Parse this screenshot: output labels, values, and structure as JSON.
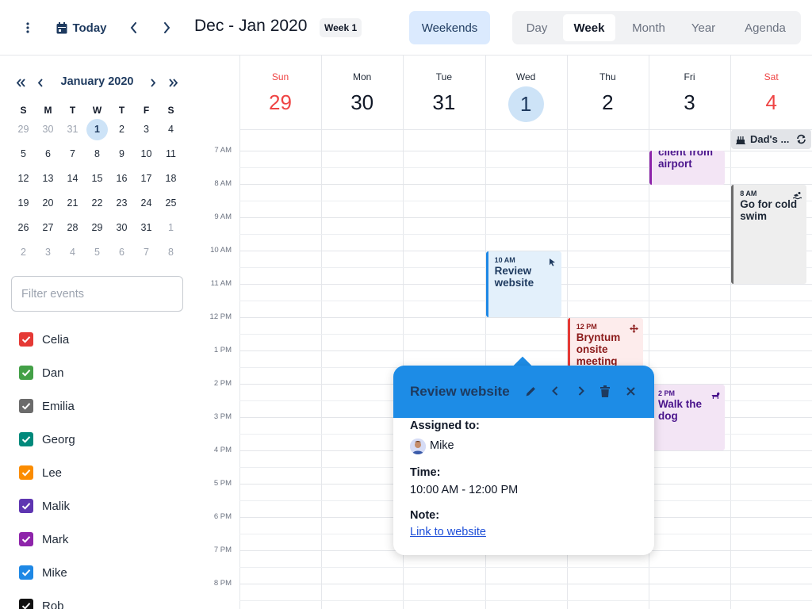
{
  "toolbar": {
    "today_label": "Today",
    "range_title": "Dec - Jan 2020",
    "week_badge": "Week 1",
    "weekends_label": "Weekends",
    "modes": [
      "Day",
      "Week",
      "Month",
      "Year",
      "Agenda"
    ],
    "active_mode": "Week"
  },
  "sidebar": {
    "month_title": "January 2020",
    "dow": [
      "S",
      "M",
      "T",
      "W",
      "T",
      "F",
      "S"
    ],
    "weeks": [
      [
        "29",
        "30",
        "31",
        "1",
        "2",
        "3",
        "4"
      ],
      [
        "5",
        "6",
        "7",
        "8",
        "9",
        "10",
        "11"
      ],
      [
        "12",
        "13",
        "14",
        "15",
        "16",
        "17",
        "18"
      ],
      [
        "19",
        "20",
        "21",
        "22",
        "23",
        "24",
        "25"
      ],
      [
        "26",
        "27",
        "28",
        "29",
        "30",
        "31",
        "1"
      ],
      [
        "2",
        "3",
        "4",
        "5",
        "6",
        "7",
        "8"
      ]
    ],
    "selected_day": "1",
    "filter_placeholder": "Filter events",
    "resources": [
      {
        "name": "Celia",
        "color": "#e53935"
      },
      {
        "name": "Dan",
        "color": "#43a047"
      },
      {
        "name": "Emilia",
        "color": "#6b6b6b"
      },
      {
        "name": "Georg",
        "color": "#00897b"
      },
      {
        "name": "Lee",
        "color": "#fb8c00"
      },
      {
        "name": "Malik",
        "color": "#5e35b1"
      },
      {
        "name": "Mark",
        "color": "#8e24aa"
      },
      {
        "name": "Mike",
        "color": "#1e88e5"
      },
      {
        "name": "Rob",
        "color": "#111111"
      }
    ]
  },
  "week": {
    "days": [
      {
        "name": "Sun",
        "num": "29",
        "weekend": true
      },
      {
        "name": "Mon",
        "num": "30"
      },
      {
        "name": "Tue",
        "num": "31"
      },
      {
        "name": "Wed",
        "num": "1",
        "today": true
      },
      {
        "name": "Thu",
        "num": "2"
      },
      {
        "name": "Fri",
        "num": "3"
      },
      {
        "name": "Sat",
        "num": "4",
        "weekend": true
      }
    ],
    "time_labels": [
      "7 AM",
      "8 AM",
      "9 AM",
      "10 AM",
      "11 AM",
      "12 PM",
      "1 PM",
      "2 PM",
      "3 PM",
      "4 PM",
      "5 PM",
      "6 PM",
      "7 PM",
      "8 PM"
    ],
    "all_day_event": {
      "name": "Dad's ...",
      "icon": "cake-icon"
    },
    "events": [
      {
        "day": 5,
        "time": "",
        "name": "client from airport",
        "color": "#8e24aa",
        "bg": "#f3e5f5",
        "text": "#4a148c"
      },
      {
        "day": 6,
        "time": "8 AM",
        "name": "Go for cold swim",
        "color": "#6b6b6b",
        "bg": "#eeeeee",
        "text": "#1f2937",
        "icon": "swimmer-icon"
      },
      {
        "day": 3,
        "time": "10 AM",
        "name": "Review website",
        "color": "#1e88e5",
        "bg": "#e3f0fb",
        "text": "#1e3a5f",
        "icon": "cursor-icon"
      },
      {
        "day": 4,
        "time": "12 PM",
        "name": "Bryntum onsite meeting",
        "color": "#e53935",
        "bg": "#fdecec",
        "text": "#8b1a1a",
        "icon": "move-icon"
      },
      {
        "day": 5,
        "time": "2 PM",
        "name": "Walk the dog",
        "color": "#8e24aa",
        "bg": "#f3e5f5",
        "text": "#4a148c",
        "icon": "dog-icon"
      }
    ]
  },
  "popup": {
    "title": "Review website",
    "assigned_label": "Assigned to:",
    "assignee": "Mike",
    "time_label": "Time:",
    "time_value": "10:00 AM - 12:00 PM",
    "note_label": "Note:",
    "note_link": "Link to website"
  }
}
